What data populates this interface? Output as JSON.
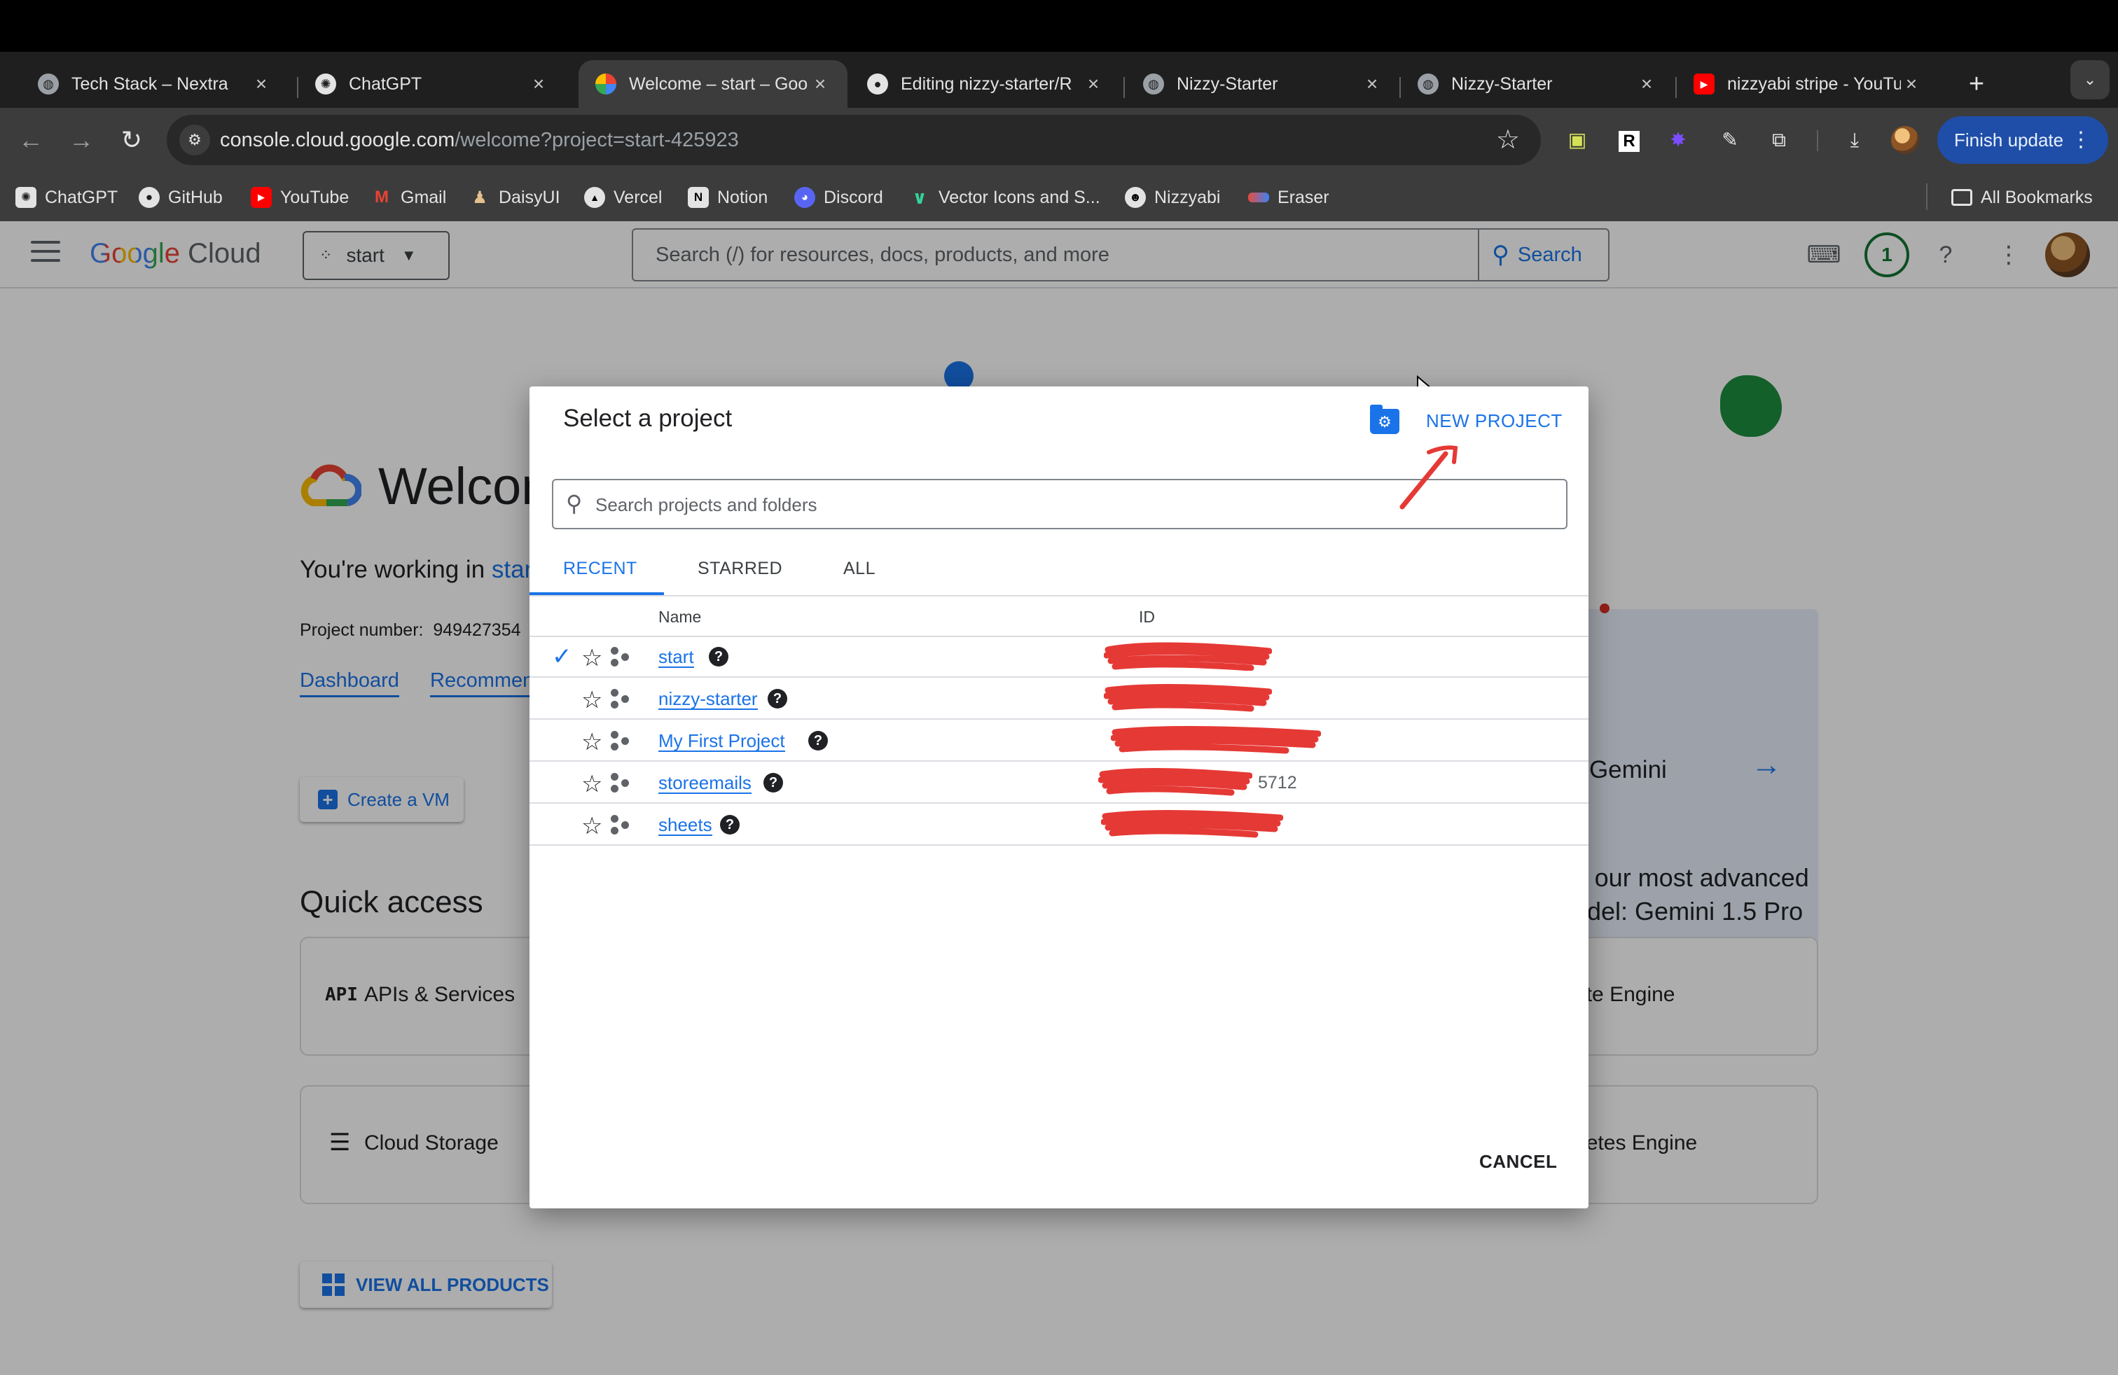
{
  "browser": {
    "tabs": [
      {
        "title": "Tech Stack – Nextra",
        "icon": "globe-icon",
        "active": false
      },
      {
        "title": "ChatGPT",
        "icon": "chatgpt-icon",
        "active": false
      },
      {
        "title": "Welcome – start – Goo",
        "icon": "google-cloud-icon",
        "active": true
      },
      {
        "title": "Editing nizzy-starter/R",
        "icon": "github-icon",
        "active": false
      },
      {
        "title": "Nizzy-Starter",
        "icon": "globe-icon",
        "active": false
      },
      {
        "title": "Nizzy-Starter",
        "icon": "globe-icon",
        "active": false
      },
      {
        "title": "nizzyabi stripe - YouTu",
        "icon": "youtube-icon",
        "active": false
      }
    ],
    "url_host": "console.cloud.google.com",
    "url_path": "/welcome?project=start-425923",
    "finish_update_label": "Finish update",
    "bookmarks": [
      {
        "label": "ChatGPT",
        "color": "#ffffff"
      },
      {
        "label": "GitHub",
        "color": "#ffffff"
      },
      {
        "label": "YouTube",
        "color": "#ff0000"
      },
      {
        "label": "Gmail",
        "color": "#ea4335"
      },
      {
        "label": "DaisyUI",
        "color": "#e3c08c"
      },
      {
        "label": "Vercel",
        "color": "#ffffff"
      },
      {
        "label": "Notion",
        "color": "#ffffff"
      },
      {
        "label": "Discord",
        "color": "#5865f2"
      },
      {
        "label": "Vector Icons and S...",
        "color": "#34d399"
      },
      {
        "label": "Nizzyabi",
        "color": "#ffffff"
      },
      {
        "label": "Eraser",
        "color": "#e74c3c"
      }
    ],
    "all_bookmarks_label": "All Bookmarks"
  },
  "console": {
    "logo_google": "Google",
    "logo_cloud": "Cloud",
    "project_picker_label": "start",
    "search_placeholder": "Search (/) for resources, docs, products, and more",
    "search_button_label": "Search",
    "notification_count": "1",
    "welcome_title": "Welcome",
    "working_in_prefix": "You're working in",
    "working_in_project": "start",
    "project_number_label": "Project number:",
    "project_number_value": "949427354",
    "links": [
      "Dashboard",
      "Recommendations"
    ],
    "create_vm_label": "Create a VM",
    "quick_access_title": "Quick access",
    "quick_access_left": [
      {
        "icon": "API",
        "label": "APIs & Services"
      },
      {
        "icon": "storage-icon",
        "label": "Cloud Storage"
      }
    ],
    "quick_access_right": [
      "Compute Engine",
      "Kubernetes Engine"
    ],
    "view_all_label": "VIEW ALL PRODUCTS",
    "gemini_text_line1": "Try our most advanced",
    "gemini_text_line2": "model: Gemini 1.5 Pro",
    "gemini_link": "Try Gemini"
  },
  "dialog": {
    "title": "Select a project",
    "new_project_label": "NEW PROJECT",
    "search_placeholder": "Search projects and folders",
    "tabs": [
      "RECENT",
      "STARRED",
      "ALL"
    ],
    "active_tab": "RECENT",
    "columns": [
      "Name",
      "ID"
    ],
    "projects": [
      {
        "name": "start",
        "selected": true,
        "id_visible": ""
      },
      {
        "name": "nizzy-starter",
        "selected": false,
        "id_visible": ""
      },
      {
        "name": "My First Project",
        "selected": false,
        "id_visible": ""
      },
      {
        "name": "storeemails",
        "selected": false,
        "id_visible": "5712"
      },
      {
        "name": "sheets",
        "selected": false,
        "id_visible": ""
      }
    ],
    "cancel_label": "CANCEL"
  },
  "colors": {
    "accent": "#1a73e8",
    "redaction": "#e53935",
    "annotation": "#e53935"
  }
}
